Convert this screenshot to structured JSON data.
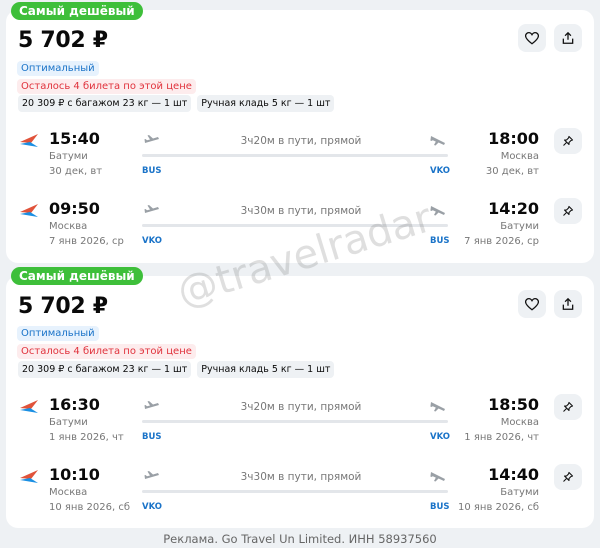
{
  "watermark": "@travelradar",
  "footer": "Реклама. Go Travel Un Limited. ИНН 58937560",
  "colors": {
    "badge": "#3ebf3a",
    "accent": "#1a73c8",
    "warning": "#e0323c",
    "airline_logo": [
      "#e1533a",
      "#1a8fe3"
    ]
  },
  "icons": {
    "favorite": "heart-icon",
    "share": "share-icon",
    "pin": "pin-icon",
    "takeoff": "plane-takeoff-icon",
    "landing": "plane-landing-icon"
  },
  "cards": [
    {
      "badge": "Самый дешёвый",
      "price": "5 702 ₽",
      "fare_tag": "Оптимальный",
      "seats_left": "Осталось 4 билета по этой цене",
      "baggage_option": "20 309 ₽ с багажом 23 кг — 1 шт",
      "carry_on": "Ручная кладь 5 кг — 1 шт",
      "segments": [
        {
          "dep_time": "15:40",
          "dep_city": "Батуми",
          "dep_date": "30 дек, вт",
          "dep_code": "BUS",
          "duration": "3ч20м в пути, прямой",
          "arr_time": "18:00",
          "arr_city": "Москва",
          "arr_date": "30 дек, вт",
          "arr_code": "VKO"
        },
        {
          "dep_time": "09:50",
          "dep_city": "Москва",
          "dep_date": "7 янв 2026, ср",
          "dep_code": "VKO",
          "duration": "3ч30м в пути, прямой",
          "arr_time": "14:20",
          "arr_city": "Батуми",
          "arr_date": "7 янв 2026, ср",
          "arr_code": "BUS"
        }
      ]
    },
    {
      "badge": "Самый дешёвый",
      "price": "5 702 ₽",
      "fare_tag": "Оптимальный",
      "seats_left": "Осталось 4 билета по этой цене",
      "baggage_option": "20 309 ₽ с багажом 23 кг — 1 шт",
      "carry_on": "Ручная кладь 5 кг — 1 шт",
      "segments": [
        {
          "dep_time": "16:30",
          "dep_city": "Батуми",
          "dep_date": "1 янв 2026, чт",
          "dep_code": "BUS",
          "duration": "3ч20м в пути, прямой",
          "arr_time": "18:50",
          "arr_city": "Москва",
          "arr_date": "1 янв 2026, чт",
          "arr_code": "VKO"
        },
        {
          "dep_time": "10:10",
          "dep_city": "Москва",
          "dep_date": "10 янв 2026, сб",
          "dep_code": "VKO",
          "duration": "3ч30м в пути, прямой",
          "arr_time": "14:40",
          "arr_city": "Батуми",
          "arr_date": "10 янв 2026, сб",
          "arr_code": "BUS"
        }
      ]
    }
  ]
}
